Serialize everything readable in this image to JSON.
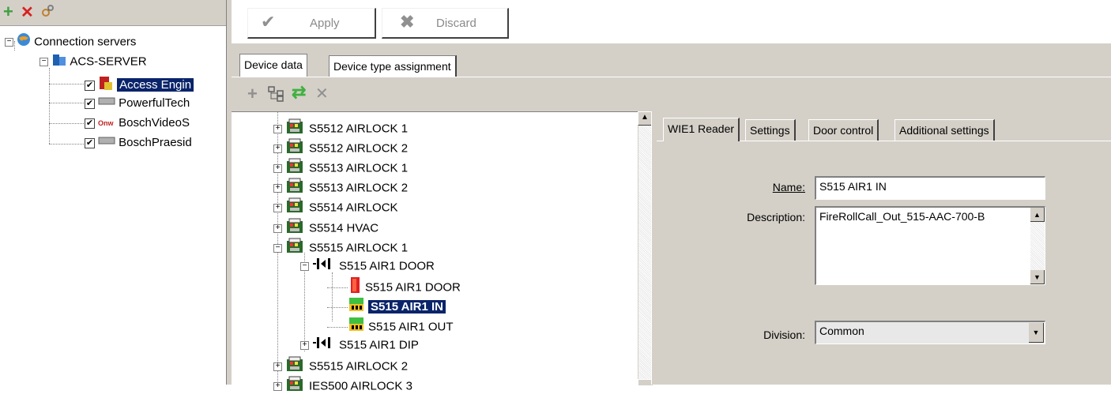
{
  "left_toolbar": {
    "add_icon": "plus-icon",
    "delete_icon": "red-x-icon",
    "connect_icon": "connect-icon"
  },
  "left_tree": {
    "root": "Connection servers",
    "server": "ACS-SERVER",
    "items": [
      {
        "label": "Access Engin",
        "checked": true,
        "selected": true,
        "icon": "access-engine-icon"
      },
      {
        "label": "PowerfulTech",
        "checked": true,
        "selected": false,
        "icon": "device-icon"
      },
      {
        "label": "BoschVideoS",
        "checked": true,
        "selected": false,
        "icon": "video-icon"
      },
      {
        "label": "BoschPraesid",
        "checked": true,
        "selected": false,
        "icon": "device-icon"
      }
    ]
  },
  "toolbar": {
    "apply_label": "Apply",
    "discard_label": "Discard"
  },
  "tabs": [
    {
      "label": "Device data",
      "active": true
    },
    {
      "label": "Device type assignment",
      "active": false
    }
  ],
  "device_tree": {
    "items": [
      {
        "label": "S5512 AIRLOCK 1",
        "level": 0,
        "expander": "+",
        "icon": "controller-icon"
      },
      {
        "label": "S5512 AIRLOCK 2",
        "level": 0,
        "expander": "+",
        "icon": "controller-icon"
      },
      {
        "label": "S5513 AIRLOCK 1",
        "level": 0,
        "expander": "+",
        "icon": "controller-icon"
      },
      {
        "label": "S5513 AIRLOCK 2",
        "level": 0,
        "expander": "+",
        "icon": "controller-icon"
      },
      {
        "label": "S5514 AIRLOCK",
        "level": 0,
        "expander": "+",
        "icon": "controller-icon"
      },
      {
        "label": "S5514 HVAC",
        "level": 0,
        "expander": "+",
        "icon": "controller-icon"
      },
      {
        "label": "S5515 AIRLOCK 1",
        "level": 0,
        "expander": "-",
        "icon": "controller-icon"
      },
      {
        "label": "S515 AIR1 DOOR",
        "level": 1,
        "expander": "-",
        "icon": "door-entrance-icon"
      },
      {
        "label": "S515 AIR1 DOOR",
        "level": 2,
        "expander": "",
        "icon": "door-icon"
      },
      {
        "label": "S515 AIR1 IN",
        "level": 2,
        "expander": "",
        "icon": "reader-icon",
        "selected": true
      },
      {
        "label": "S515 AIR1 OUT",
        "level": 2,
        "expander": "",
        "icon": "reader-icon"
      },
      {
        "label": "S515 AIR1 DIP",
        "level": 1,
        "expander": "+",
        "icon": "door-entrance-icon"
      },
      {
        "label": "S5515 AIRLOCK 2",
        "level": 0,
        "expander": "+",
        "icon": "controller-icon"
      },
      {
        "label": "IES500 AIRLOCK 3",
        "level": 0,
        "expander": "+",
        "icon": "controller-icon"
      }
    ]
  },
  "detail_tabs": [
    {
      "label": "WIE1 Reader",
      "active": true
    },
    {
      "label": "Settings",
      "active": false
    },
    {
      "label": "Door control",
      "active": false
    },
    {
      "label": "Additional settings",
      "active": false
    }
  ],
  "form": {
    "name_label": "Name:",
    "name_value": "S515 AIR1 IN",
    "description_label": "Description:",
    "description_value": "FireRollCall_Out_515-AAC-700-B",
    "division_label": "Division:",
    "division_value": "Common"
  },
  "colors": {
    "selection": "#0a246a",
    "panel": "#d4d0c8"
  }
}
